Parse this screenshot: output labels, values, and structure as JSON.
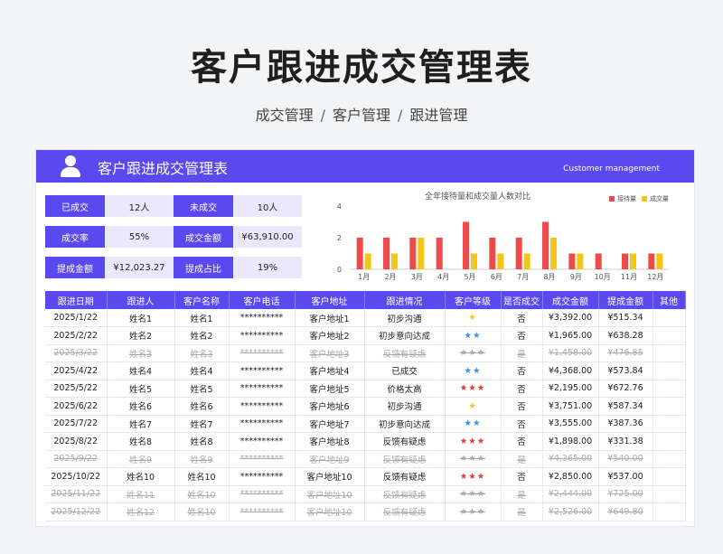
{
  "page": {
    "title": "客户跟进成交管理表",
    "breadcrumbs": [
      "成交管理",
      "客户管理",
      "跟进管理"
    ],
    "separator": "/"
  },
  "card": {
    "title": "客户跟进成交管理表",
    "subtitle_en": "Customer management"
  },
  "stats": [
    {
      "label1": "已成交",
      "value1": "12人",
      "label2": "未成交",
      "value2": "10人"
    },
    {
      "label1": "成交率",
      "value1": "55%",
      "label2": "成交金额",
      "value2": "¥63,910.00"
    },
    {
      "label1": "提成金额",
      "value1": "¥12,023.27",
      "label2": "提成占比",
      "value2": "19%"
    }
  ],
  "chart_data": {
    "type": "bar",
    "title": "全年接待量和成交量人数对比",
    "categories": [
      "1月",
      "2月",
      "3月",
      "4月",
      "5月",
      "6月",
      "7月",
      "8月",
      "9月",
      "10月",
      "11月",
      "12月"
    ],
    "series": [
      {
        "name": "接待量",
        "color": "#ef4a4a",
        "values": [
          2,
          2,
          2,
          2,
          3,
          2,
          2,
          3,
          1,
          1,
          1,
          1
        ]
      },
      {
        "name": "成交量",
        "color": "#f5c518",
        "values": [
          1,
          1,
          2,
          0,
          1,
          1,
          1,
          2,
          1,
          0,
          1,
          1
        ]
      }
    ],
    "ylim": [
      0,
      4
    ],
    "yticks": [
      0,
      2,
      4
    ],
    "legend": "top-right"
  },
  "table": {
    "headers": [
      "跟进日期",
      "跟进人",
      "客户名称",
      "客户电话",
      "客户地址",
      "跟进情况",
      "客户等级",
      "是否成交",
      "成交金额",
      "提成金额",
      "其他"
    ],
    "rows": [
      {
        "date": "2025/1/22",
        "person": "姓名1",
        "customer": "姓名1",
        "phone": "**********",
        "address": "客户地址1",
        "status": "初步沟通",
        "stars": "★",
        "star_color": "#f5c518",
        "deal": "否",
        "amount": "¥3,392.00",
        "commission": "¥515.34",
        "other": "",
        "done": false
      },
      {
        "date": "2025/2/22",
        "person": "姓名2",
        "customer": "姓名2",
        "phone": "**********",
        "address": "客户地址2",
        "status": "初步意向达成",
        "stars": "★★",
        "star_color": "#3b8fe0",
        "deal": "否",
        "amount": "¥1,965.00",
        "commission": "¥638.28",
        "other": "",
        "done": false
      },
      {
        "date": "2025/3/22",
        "person": "姓名3",
        "customer": "姓名3",
        "phone": "**********",
        "address": "客户地址3",
        "status": "反馈有疑虑",
        "stars": "★★★",
        "star_color": "#aaaaaa",
        "deal": "是",
        "amount": "¥1,458.00",
        "commission": "¥476.85",
        "other": "",
        "done": true
      },
      {
        "date": "2025/4/22",
        "person": "姓名4",
        "customer": "姓名4",
        "phone": "**********",
        "address": "客户地址4",
        "status": "已成交",
        "stars": "★★",
        "star_color": "#3b8fe0",
        "deal": "否",
        "amount": "¥4,368.00",
        "commission": "¥573.84",
        "other": "",
        "done": false
      },
      {
        "date": "2025/5/22",
        "person": "姓名5",
        "customer": "姓名5",
        "phone": "**********",
        "address": "客户地址5",
        "status": "价格太高",
        "stars": "★★★",
        "star_color": "#e53935",
        "deal": "否",
        "amount": "¥2,195.00",
        "commission": "¥672.76",
        "other": "",
        "done": false
      },
      {
        "date": "2025/6/22",
        "person": "姓名6",
        "customer": "姓名6",
        "phone": "**********",
        "address": "客户地址6",
        "status": "初步沟通",
        "stars": "★",
        "star_color": "#f5c518",
        "deal": "否",
        "amount": "¥3,751.00",
        "commission": "¥587.34",
        "other": "",
        "done": false
      },
      {
        "date": "2025/7/22",
        "person": "姓名7",
        "customer": "姓名7",
        "phone": "**********",
        "address": "客户地址7",
        "status": "初步意向达成",
        "stars": "★★",
        "star_color": "#3b8fe0",
        "deal": "否",
        "amount": "¥3,555.00",
        "commission": "¥387.36",
        "other": "",
        "done": false
      },
      {
        "date": "2025/8/22",
        "person": "姓名8",
        "customer": "姓名8",
        "phone": "**********",
        "address": "客户地址8",
        "status": "反馈有疑虑",
        "stars": "★★★",
        "star_color": "#e53935",
        "deal": "否",
        "amount": "¥1,898.00",
        "commission": "¥331.38",
        "other": "",
        "done": false
      },
      {
        "date": "2025/9/22",
        "person": "姓名9",
        "customer": "姓名9",
        "phone": "**********",
        "address": "客户地址9",
        "status": "反馈有疑虑",
        "stars": "★★★",
        "star_color": "#aaaaaa",
        "deal": "是",
        "amount": "¥4,365.00",
        "commission": "¥540.00",
        "other": "",
        "done": true
      },
      {
        "date": "2025/10/22",
        "person": "姓名10",
        "customer": "姓名10",
        "phone": "**********",
        "address": "客户地址10",
        "status": "反馈有疑虑",
        "stars": "★★★",
        "star_color": "#e53935",
        "deal": "否",
        "amount": "¥2,850.00",
        "commission": "¥537.00",
        "other": "",
        "done": false
      },
      {
        "date": "2025/11/22",
        "person": "姓名11",
        "customer": "姓名10",
        "phone": "**********",
        "address": "客户地址10",
        "status": "反馈有疑虑",
        "stars": "★★★",
        "star_color": "#aaaaaa",
        "deal": "是",
        "amount": "¥2,444.00",
        "commission": "¥725.00",
        "other": "",
        "done": true
      },
      {
        "date": "2025/12/22",
        "person": "姓名12",
        "customer": "姓名10",
        "phone": "**********",
        "address": "客户地址10",
        "status": "反馈有疑虑",
        "stars": "★★★",
        "star_color": "#aaaaaa",
        "deal": "是",
        "amount": "¥2,526.00",
        "commission": "¥649.80",
        "other": "",
        "done": true
      }
    ]
  }
}
